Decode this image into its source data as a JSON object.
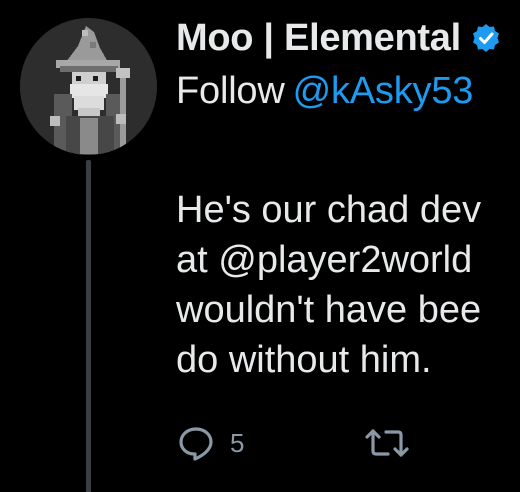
{
  "author": {
    "display_name": "Moo | Elemental",
    "avatar_icon": "pixel-wizard-avatar",
    "verified_icon": "verified-badge-icon",
    "verified_color": "#1d9bf0"
  },
  "follow": {
    "label": "Follow",
    "handle": "@kAsky53"
  },
  "tweet": {
    "lines": [
      "He's our chad dev",
      "at @player2world",
      "wouldn't have bee",
      "do without him."
    ]
  },
  "actions": {
    "reply_icon": "reply-icon",
    "reply_count": "5",
    "retweet_icon": "retweet-icon"
  },
  "colors": {
    "background": "#000000",
    "text": "#e7e9ea",
    "link": "#1d9bf0",
    "muted": "#8b98a5",
    "thread_line": "#3a3f44"
  }
}
